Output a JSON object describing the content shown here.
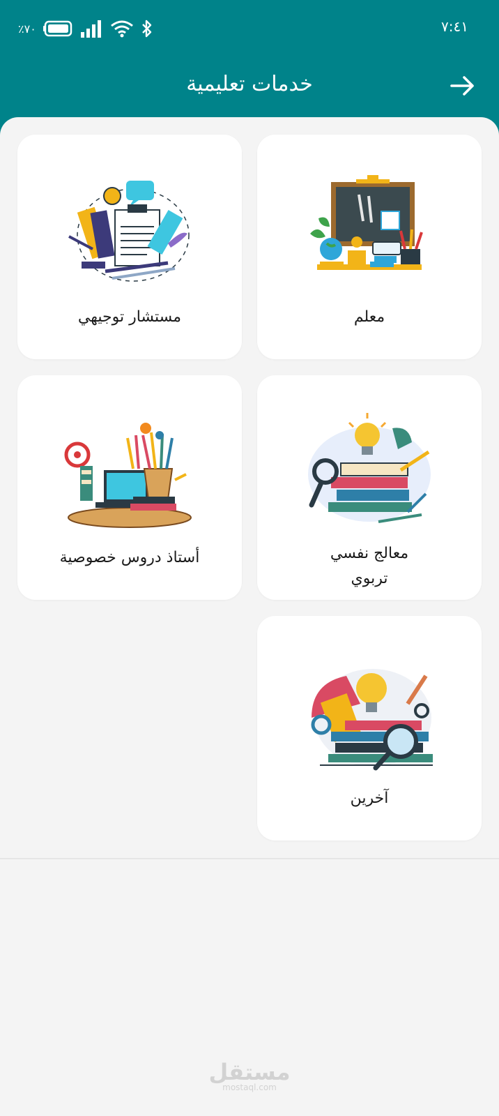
{
  "status_bar": {
    "time": "٧:٤١",
    "battery_percent": "٪٧٠"
  },
  "header": {
    "title": "خدمات تعليمية"
  },
  "cards": [
    {
      "label": "معلم",
      "icon": "teacher-illustration"
    },
    {
      "label": "مستشار توجيهي",
      "icon": "counselor-illustration"
    },
    {
      "label_line1": "معالج نفسي",
      "label_line2": "تربوي",
      "icon": "therapist-illustration"
    },
    {
      "label": "أستاذ دروس خصوصية",
      "icon": "tutor-illustration"
    },
    {
      "label": "آخرين",
      "icon": "others-illustration"
    }
  ],
  "watermark": {
    "arabic": "مستقل",
    "latin": "mostaql.com"
  },
  "colors": {
    "header": "#00838a",
    "background": "#f4f4f4",
    "card": "#ffffff"
  }
}
